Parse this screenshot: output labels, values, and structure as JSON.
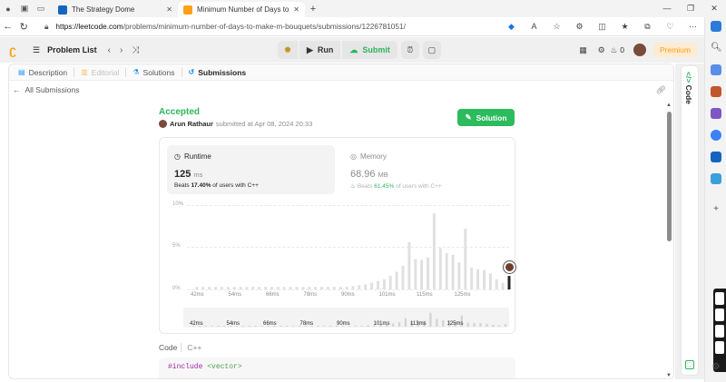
{
  "browser": {
    "tabs": [
      {
        "title": "The Strategy Dome",
        "active": false,
        "favicon_color": "#1565c0"
      },
      {
        "title": "Minimum Number of Days to Ma",
        "active": true,
        "favicon_color": "#ffa116"
      }
    ],
    "url_host": "https://leetcode.com",
    "url_path": "/problems/minimum-number-of-days-to-make-m-bouquets/submissions/1226781051/"
  },
  "nav": {
    "problem_list": "Problem List",
    "run": "Run",
    "submit": "Submit",
    "streak": "0",
    "premium": "Premium"
  },
  "panel_tabs": {
    "description": "Description",
    "editorial": "Editorial",
    "solutions": "Solutions",
    "submissions": "Submissions"
  },
  "all_submissions": "All Submissions",
  "submission": {
    "status": "Accepted",
    "user": "Arun Rathaur",
    "submitted_text": "submitted at Apr 08, 2024 20:33",
    "solution_button": "Solution"
  },
  "runtime": {
    "label": "Runtime",
    "value": "125",
    "unit": "ms",
    "beats_prefix": "Beats",
    "beats_pct": "17.40%",
    "beats_suffix": "of users with C++"
  },
  "memory": {
    "label": "Memory",
    "value": "68.96",
    "unit": "MB",
    "beats_prefix": "Beats",
    "beats_pct": "61.45%",
    "beats_suffix": "of users with C++"
  },
  "code": {
    "label": "Code",
    "language": "C++",
    "first_line_directive": "#include",
    "first_line_header": "<vector>"
  },
  "side_strip": {
    "label": "Code"
  },
  "chart_data": {
    "type": "bar",
    "title": "",
    "xlabel": "",
    "ylabel": "",
    "y_ticks": [
      "10%",
      "5%",
      "0%"
    ],
    "ylim": [
      0,
      10
    ],
    "x_ticks": [
      "42ms",
      "54ms",
      "66ms",
      "78ms",
      "90ms",
      "101ms",
      "115ms",
      "125ms"
    ],
    "brush_ticks": [
      "42ms",
      "54ms",
      "66ms",
      "78ms",
      "90ms",
      "101ms",
      "113ms",
      "125ms"
    ],
    "xlim": [
      38,
      140
    ],
    "bars": [
      {
        "x": 40,
        "y": 0.3
      },
      {
        "x": 42,
        "y": 0.3
      },
      {
        "x": 44,
        "y": 0.3
      },
      {
        "x": 46,
        "y": 0.3
      },
      {
        "x": 48,
        "y": 0.3
      },
      {
        "x": 50,
        "y": 0.3
      },
      {
        "x": 52,
        "y": 0.3
      },
      {
        "x": 54,
        "y": 0.3
      },
      {
        "x": 56,
        "y": 0.3
      },
      {
        "x": 58,
        "y": 0.3
      },
      {
        "x": 60,
        "y": 0.3
      },
      {
        "x": 62,
        "y": 0.3
      },
      {
        "x": 64,
        "y": 0.3
      },
      {
        "x": 66,
        "y": 0.3
      },
      {
        "x": 68,
        "y": 0.3
      },
      {
        "x": 70,
        "y": 0.3
      },
      {
        "x": 72,
        "y": 0.3
      },
      {
        "x": 74,
        "y": 0.3
      },
      {
        "x": 76,
        "y": 0.3
      },
      {
        "x": 78,
        "y": 0.3
      },
      {
        "x": 80,
        "y": 0.3
      },
      {
        "x": 82,
        "y": 0.3
      },
      {
        "x": 84,
        "y": 0.3
      },
      {
        "x": 86,
        "y": 0.3
      },
      {
        "x": 88,
        "y": 0.3
      },
      {
        "x": 90,
        "y": 0.4
      },
      {
        "x": 92,
        "y": 0.5
      },
      {
        "x": 94,
        "y": 0.6
      },
      {
        "x": 96,
        "y": 0.8
      },
      {
        "x": 98,
        "y": 1.0
      },
      {
        "x": 100,
        "y": 1.2
      },
      {
        "x": 102,
        "y": 1.6
      },
      {
        "x": 104,
        "y": 2.1
      },
      {
        "x": 106,
        "y": 2.8
      },
      {
        "x": 108,
        "y": 5.6
      },
      {
        "x": 110,
        "y": 3.6
      },
      {
        "x": 112,
        "y": 3.5
      },
      {
        "x": 114,
        "y": 3.8
      },
      {
        "x": 116,
        "y": 9.0
      },
      {
        "x": 118,
        "y": 4.9
      },
      {
        "x": 120,
        "y": 4.3
      },
      {
        "x": 122,
        "y": 4.1
      },
      {
        "x": 124,
        "y": 3.2
      },
      {
        "x": 126,
        "y": 7.2
      },
      {
        "x": 128,
        "y": 2.6
      },
      {
        "x": 130,
        "y": 2.4
      },
      {
        "x": 132,
        "y": 2.3
      },
      {
        "x": 134,
        "y": 1.9
      },
      {
        "x": 136,
        "y": 1.2
      },
      {
        "x": 138,
        "y": 0.8
      }
    ],
    "highlight": {
      "x": 140,
      "y": 1.6
    },
    "grid": true,
    "legend": "none",
    "colors": {
      "bar": "#e0e0e0",
      "highlight": "#262626"
    }
  },
  "colors": {
    "accent_green": "#2cbb5d",
    "brand_orange": "#ffa116",
    "link_blue": "#1a90ff"
  }
}
